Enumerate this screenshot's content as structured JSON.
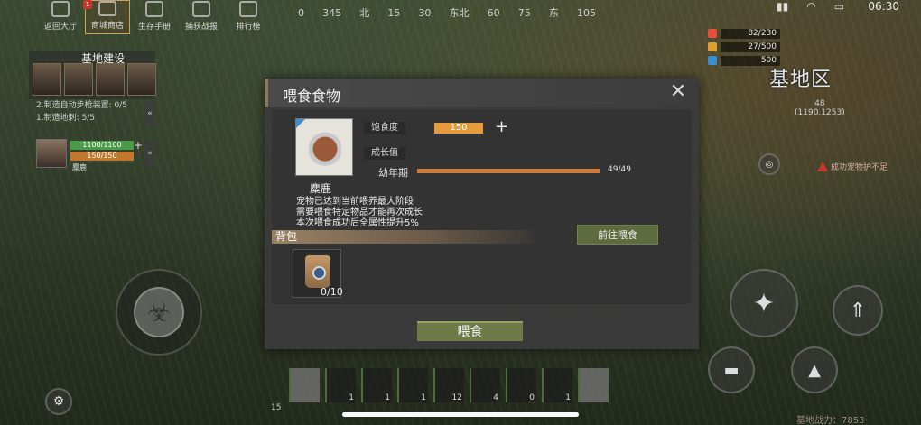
{
  "top_menu": {
    "items": [
      {
        "label": "返回大厅",
        "icon": "home-icon"
      },
      {
        "label": "商城商店",
        "icon": "shop-icon",
        "active": true
      },
      {
        "label": "生存手册",
        "icon": "book-icon"
      },
      {
        "label": "捕获战报",
        "icon": "battle-report-icon"
      },
      {
        "label": "排行榜",
        "icon": "leaderboard-icon"
      }
    ],
    "badge": "1"
  },
  "compass": [
    "0",
    "345",
    "北",
    "15",
    "30",
    "东北",
    "60",
    "75",
    "东",
    "105"
  ],
  "clock": "06:30",
  "stats": [
    {
      "value": "82/230",
      "color": "#e74c3c",
      "icon": "heart-icon"
    },
    {
      "value": "27/500",
      "color": "#e0a030",
      "icon": "food-icon"
    },
    {
      "value": "500",
      "color": "#3a8fd0",
      "icon": "water-icon"
    }
  ],
  "map": {
    "label": "基地区",
    "coords_top": "48",
    "coords": "(1190,1253)"
  },
  "warning": "成功宠物护不足",
  "base": {
    "title": "基地建设",
    "tasks": [
      "2.制造自动步枪装置: 0/5",
      "1.制造地刺: 5/5"
    ],
    "hero_hp": "1100/1100",
    "hero_sp": "150/150",
    "hero_name": "麋鹿"
  },
  "modal": {
    "title": "喂食食物",
    "satiety_label": "饱食度",
    "satiety_value": "150",
    "growth_label": "成长值",
    "pet_name": "麋鹿",
    "stage": "幼年期",
    "growth_text": "49/49",
    "growth_progress": 1.0,
    "description": [
      "宠物已达到当前喂养最大阶段",
      "需要喂食特定物品才能再次成长",
      "本次喂食成功后全属性提升5%"
    ],
    "bag_label": "背包",
    "go_feed_label": "前往喂食",
    "bag_count": "0/10",
    "feed_label": "喂食"
  },
  "hotbar": [
    {
      "count": ""
    },
    {
      "count": "1"
    },
    {
      "count": "1"
    },
    {
      "count": "1"
    },
    {
      "count": "12"
    },
    {
      "count": "4"
    },
    {
      "count": "0"
    },
    {
      "count": "1"
    },
    {
      "count": ""
    }
  ],
  "level": "15",
  "power": "基地战力：7853"
}
